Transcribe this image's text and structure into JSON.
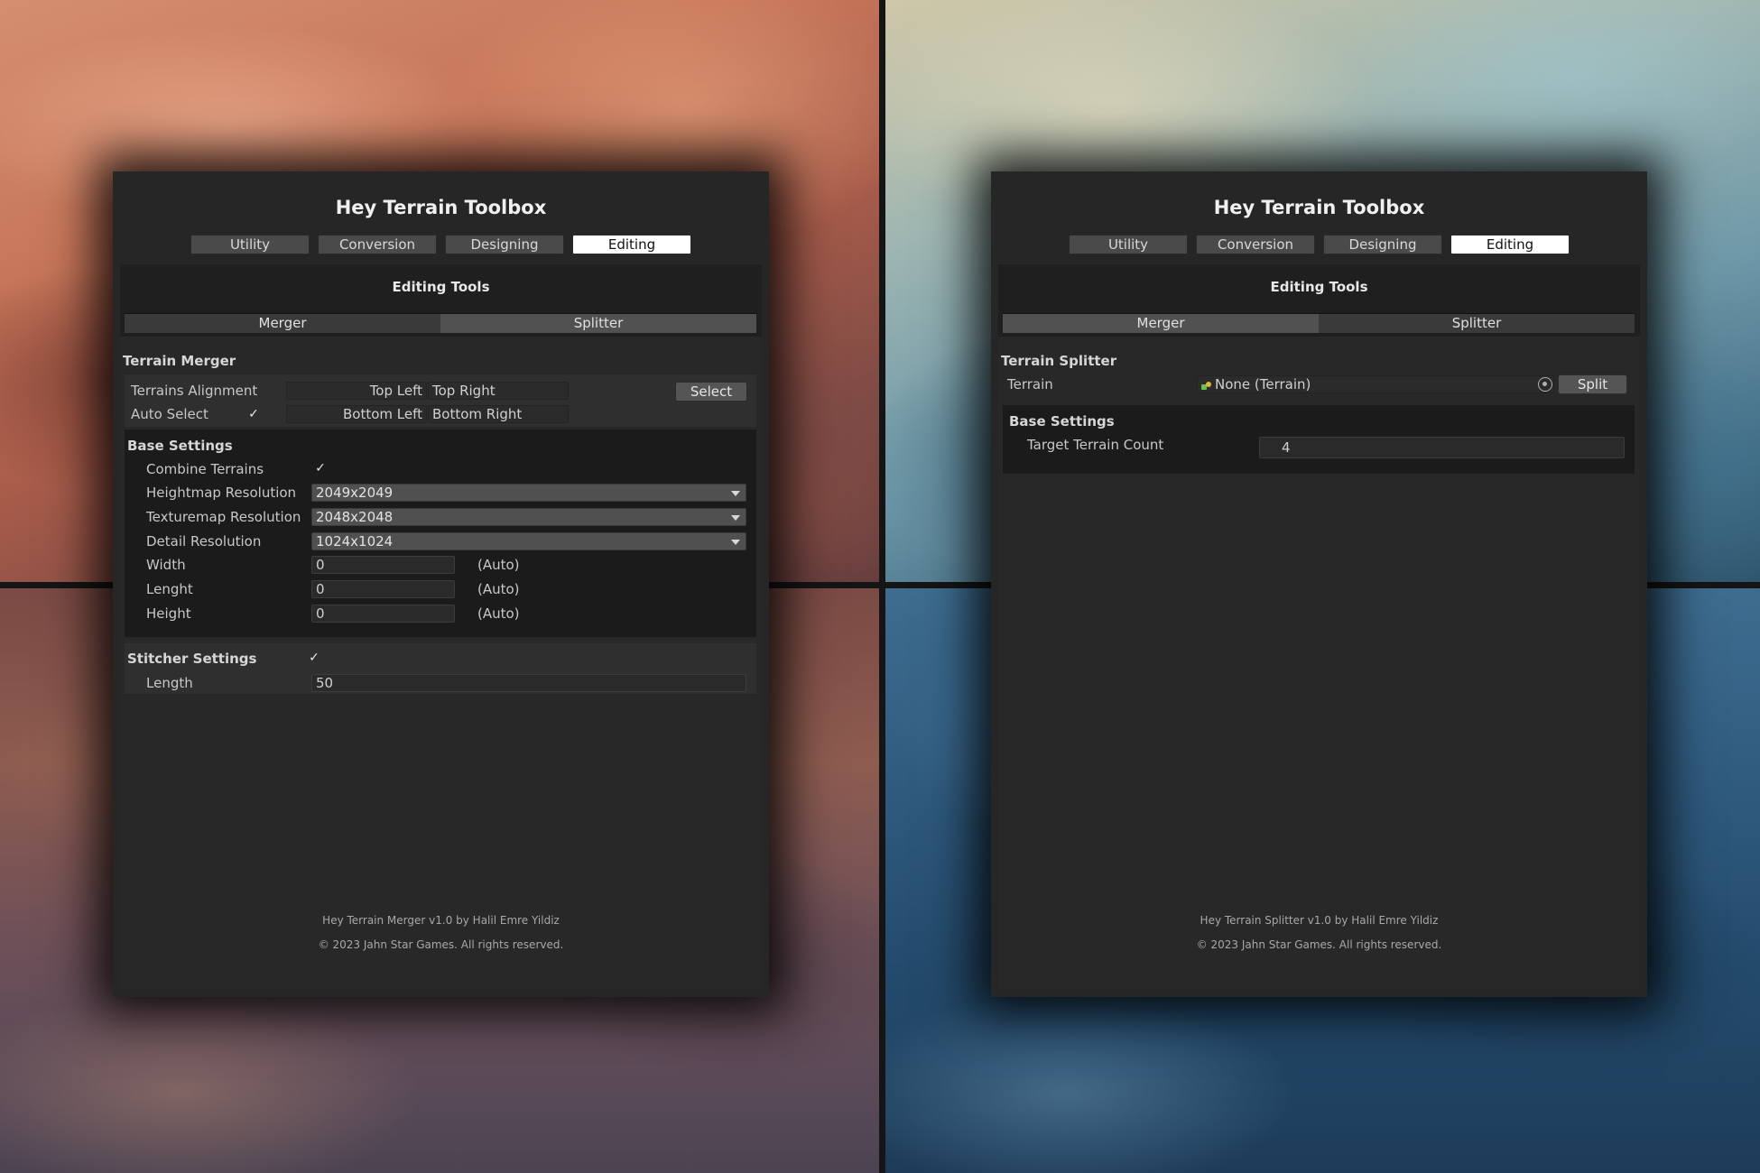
{
  "left_panel": {
    "title": "Hey Terrain Toolbox",
    "tabs": [
      "Utility",
      "Conversion",
      "Designing",
      "Editing"
    ],
    "section_title": "Editing Tools",
    "subtabs": [
      "Merger",
      "Splitter"
    ],
    "merger": {
      "header": "Terrain Merger",
      "alignment_label": "Terrains Alignment",
      "auto_select_label": "Auto Select",
      "auto_select_checked": "✓",
      "slots": [
        "Top Left",
        "Top Right",
        "Bottom Left",
        "Bottom Right"
      ],
      "select_button": "Select"
    },
    "base_settings": {
      "header": "Base Settings",
      "combine_label": "Combine Terrains",
      "combine_checked": "✓",
      "heightmap_label": "Heightmap Resolution",
      "heightmap_value": "2049x2049",
      "texturemap_label": "Texturemap Resolution",
      "texturemap_value": "2048x2048",
      "detail_label": "Detail Resolution",
      "detail_value": "1024x1024",
      "width_label": "Width",
      "width_value": "0",
      "length_label": "Lenght",
      "length_value": "0",
      "height_label": "Height",
      "height_value": "0",
      "auto_text": "(Auto)"
    },
    "stitcher": {
      "header": "Stitcher Settings",
      "checked": "✓",
      "length_label": "Length",
      "length_value": "50"
    },
    "footer_line1": "Hey Terrain Merger v1.0 by Halil Emre Yildiz",
    "footer_line2": "© 2023 Jahn Star Games. All rights reserved."
  },
  "right_panel": {
    "title": "Hey Terrain Toolbox",
    "tabs": [
      "Utility",
      "Conversion",
      "Designing",
      "Editing"
    ],
    "section_title": "Editing Tools",
    "subtabs": [
      "Merger",
      "Splitter"
    ],
    "splitter": {
      "header": "Terrain Splitter",
      "terrain_label": "Terrain",
      "terrain_value": "None (Terrain)",
      "split_button": "Split"
    },
    "base_settings": {
      "header": "Base Settings",
      "target_count_label": "Target Terrain Count",
      "target_count_value": "4"
    },
    "footer_line1": "Hey Terrain Splitter v1.0 by Halil Emre Yildiz",
    "footer_line2": "© 2023 Jahn Star Games. All rights reserved."
  }
}
